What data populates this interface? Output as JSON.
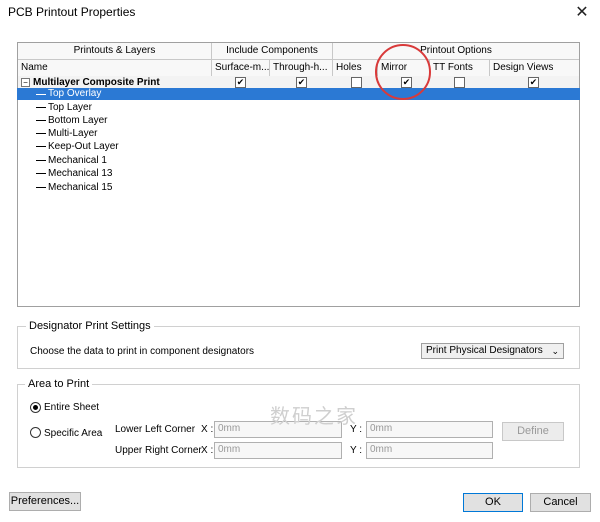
{
  "window": {
    "title": "PCB Printout Properties",
    "close_glyph": "✕"
  },
  "table": {
    "group_headers": [
      "Printouts & Layers",
      "Include Components",
      "Printout Options"
    ],
    "columns": [
      "Name",
      "Surface-m...",
      "Through-h...",
      "Holes",
      "Mirror",
      "TT Fonts",
      "Design Views"
    ],
    "root": {
      "label": "Multilayer Composite Print",
      "expander": "−",
      "checks": [
        true,
        true,
        false,
        true,
        false,
        true
      ]
    },
    "layers": [
      "Top Overlay",
      "Top Layer",
      "Bottom Layer",
      "Multi-Layer",
      "Keep-Out Layer",
      "Mechanical 1",
      "Mechanical 13",
      "Mechanical 15"
    ],
    "check_glyph": "✔"
  },
  "designator": {
    "group_title": "Designator Print Settings",
    "prompt": "Choose the data to print in component designators",
    "selected": "Print Physical Designators",
    "arrow": "⌄"
  },
  "area": {
    "group_title": "Area to Print",
    "entire_label": "Entire Sheet",
    "specific_label": "Specific Area",
    "lower_left_label": "Lower Left Corner",
    "upper_right_label": "Upper Right Corner",
    "x_label": "X :",
    "y_label": "Y :",
    "ll_x": "0mm",
    "ll_y": "0mm",
    "ur_x": "0mm",
    "ur_y": "0mm",
    "define_label": "Define"
  },
  "footer": {
    "preferences_label": "Preferences...",
    "ok_label": "OK",
    "cancel_label": "Cancel"
  },
  "watermark": "数码之家",
  "colors": {
    "selection": "#2b79d4",
    "highlight_circle": "#d93a3a"
  }
}
